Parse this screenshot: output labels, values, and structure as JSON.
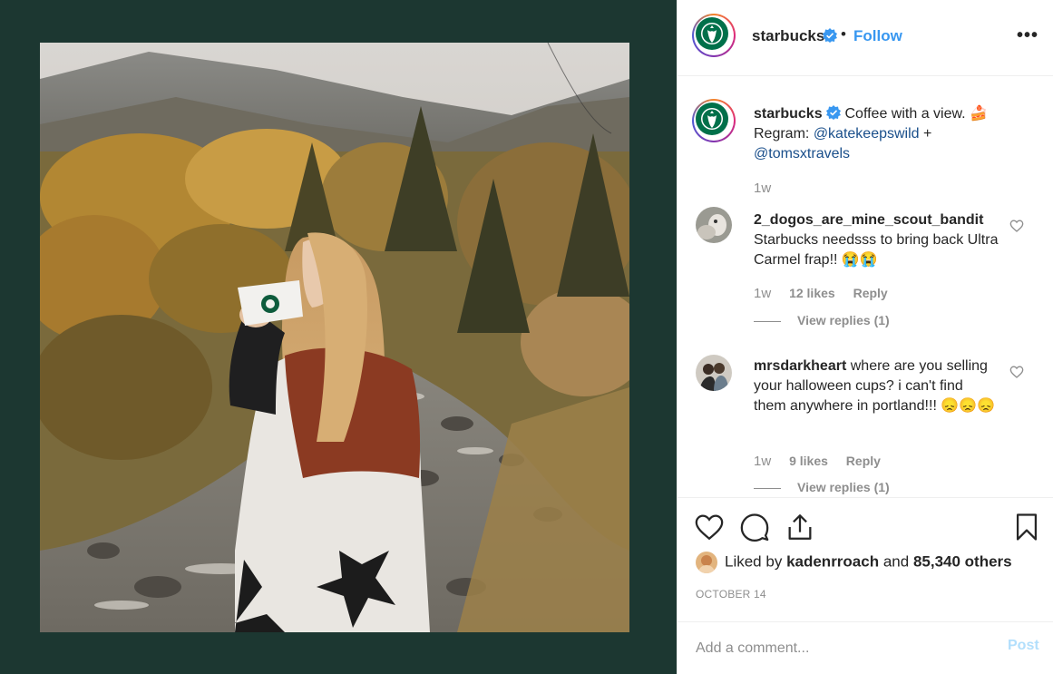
{
  "post": {
    "username": "starbucks",
    "follow_label": "Follow",
    "dot": "•",
    "more_label": "•••"
  },
  "caption": {
    "username": "starbucks",
    "text": "Coffee with a view.",
    "emoji": "🍰",
    "regram_prefix": "Regram:",
    "mention1": "@katekeepswild",
    "plus": "+",
    "mention2": "@tomsxtravels",
    "time": "1w"
  },
  "comments": [
    {
      "username": "2_dogos_are_mine_scout_bandit",
      "text": "Starbucks needsss to bring back Ultra Carmel frap!! 😭😭",
      "time": "1w",
      "likes": "12 likes",
      "reply_label": "Reply",
      "view_replies": "View replies (1)"
    },
    {
      "username": "mrsdarkheart",
      "text": "where are you selling your halloween cups? i can't find them anywhere in portland!!! 😞😞😞",
      "time": "1w",
      "likes": "9 likes",
      "reply_label": "Reply",
      "view_replies": "View replies (1)"
    }
  ],
  "likes": {
    "prefix": "Liked by",
    "user": "kadenrroach",
    "and": "and",
    "others": "85,340 others"
  },
  "date": "OCTOBER 14",
  "add_comment": {
    "placeholder": "Add a comment...",
    "post_label": "Post"
  },
  "colors": {
    "left_bg": "#1c3731",
    "link_blue": "#3897f0",
    "post_disabled": "#b2dffc",
    "verified": "#3897f0",
    "starbucks_green": "#00704a"
  }
}
